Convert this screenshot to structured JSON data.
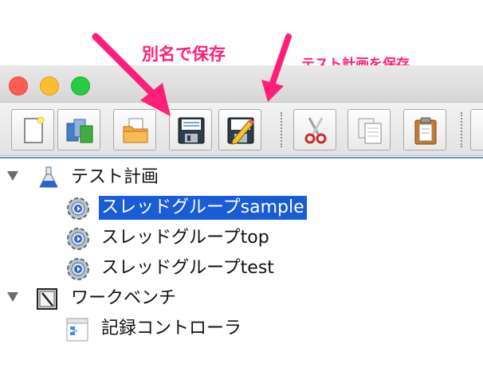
{
  "annotations": {
    "save_as": "別名で保存",
    "save_test_plan": "テスト計画を保存"
  },
  "colors": {
    "annotation": "#ff1f7a",
    "selection": "#1a5bd6",
    "close": "#fc5d56",
    "minimize": "#fdbd2e",
    "maximize": "#2aca44"
  },
  "toolbar": {
    "buttons": [
      {
        "icon": "new-document-icon"
      },
      {
        "icon": "templates-icon"
      },
      {
        "icon": "open-folder-icon"
      },
      {
        "icon": "floppy-disk-save-icon"
      },
      {
        "icon": "floppy-disk-pencil-icon"
      },
      {
        "icon": "scissors-cut-icon"
      },
      {
        "icon": "copy-icon"
      },
      {
        "icon": "clipboard-paste-icon"
      }
    ]
  },
  "tree": {
    "test_plan": "テスト計画",
    "thread_groups": [
      "スレッドグループsample",
      "スレッドグループtop",
      "スレッドグループtest"
    ],
    "selected_index": 0,
    "workbench": "ワークベンチ",
    "recording_controller": "記録コントローラ"
  }
}
